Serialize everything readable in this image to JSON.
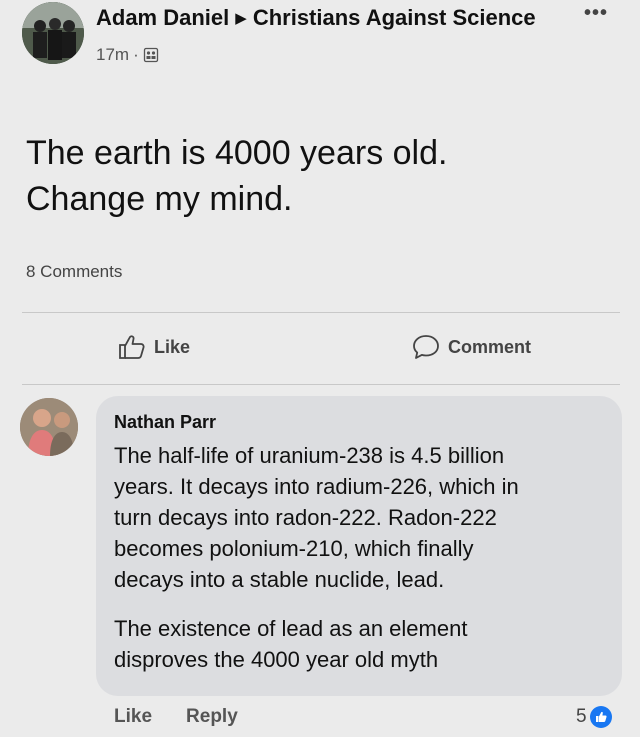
{
  "post": {
    "author": "Adam Daniel",
    "group": "Christians Against Science",
    "time": "17m",
    "text_line1": "The earth is 4000 years old.",
    "text_line2": "Change my mind.",
    "comments_count": "8 Comments",
    "icons": {
      "more": "more-options-icon",
      "audience": "group-audience-icon",
      "arrow": "right-triangle-icon"
    }
  },
  "actions": {
    "like": "Like",
    "comment": "Comment"
  },
  "comment": {
    "author": "Nathan Parr",
    "paragraph1_l1": "The half-life of uranium-238 is 4.5 billion",
    "paragraph1_l2": "years. It decays into radium-226, which in",
    "paragraph1_l3": "turn decays into radon-222. Radon-222",
    "paragraph1_l4": "becomes polonium-210, which finally",
    "paragraph1_l5": "decays into a stable nuclide, lead.",
    "paragraph2_l1": "The existence of lead as an element",
    "paragraph2_l2": "disproves the 4000 year old myth",
    "like_label": "Like",
    "reply_label": "Reply",
    "reaction_count": "5"
  },
  "colors": {
    "background": "#ebebeb",
    "bubble": "#dcdde0",
    "like_blue": "#1877f2"
  }
}
